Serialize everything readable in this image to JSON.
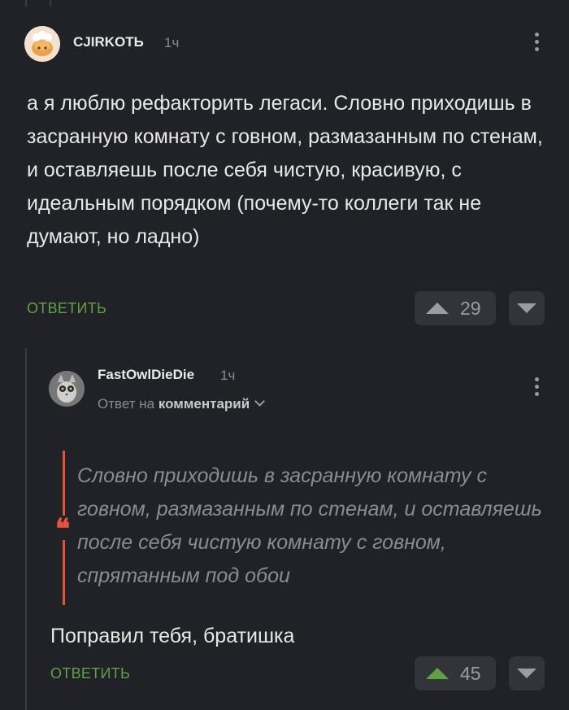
{
  "comment1": {
    "username": "CJIRKOTЬ",
    "time": "1ч",
    "text": "а я люблю рефакторить легаси. Словно приходишь в засранную комнату с говном, размазанным по стенам, и оставляешь после себя чистую, красивую, с идеальным порядком (почему-то коллеги так не думают, но ладно)",
    "reply_label": "ОТВЕТИТЬ",
    "rating": "29"
  },
  "comment2": {
    "username": "FastOwlDieDie",
    "time": "1ч",
    "answer_prefix": "Ответ на",
    "answer_target": "комментарий",
    "quote": "Словно приходишь в засранную комнату с говном, размазанным по стенам, и оставляешь после себя чистую комнату с говном, спрятанным под обои",
    "text": "Поправил тебя, братишка",
    "reply_label": "ОТВЕТИТЬ",
    "rating": "45"
  },
  "colors": {
    "background": "#212227",
    "accent_green": "#5fa243",
    "quote_red": "#e5533d",
    "vote_bg": "#33343a"
  },
  "icons": [
    "kebab-menu-icon",
    "upvote-arrow-icon",
    "downvote-arrow-icon",
    "chevron-down-icon",
    "quote-icon"
  ]
}
